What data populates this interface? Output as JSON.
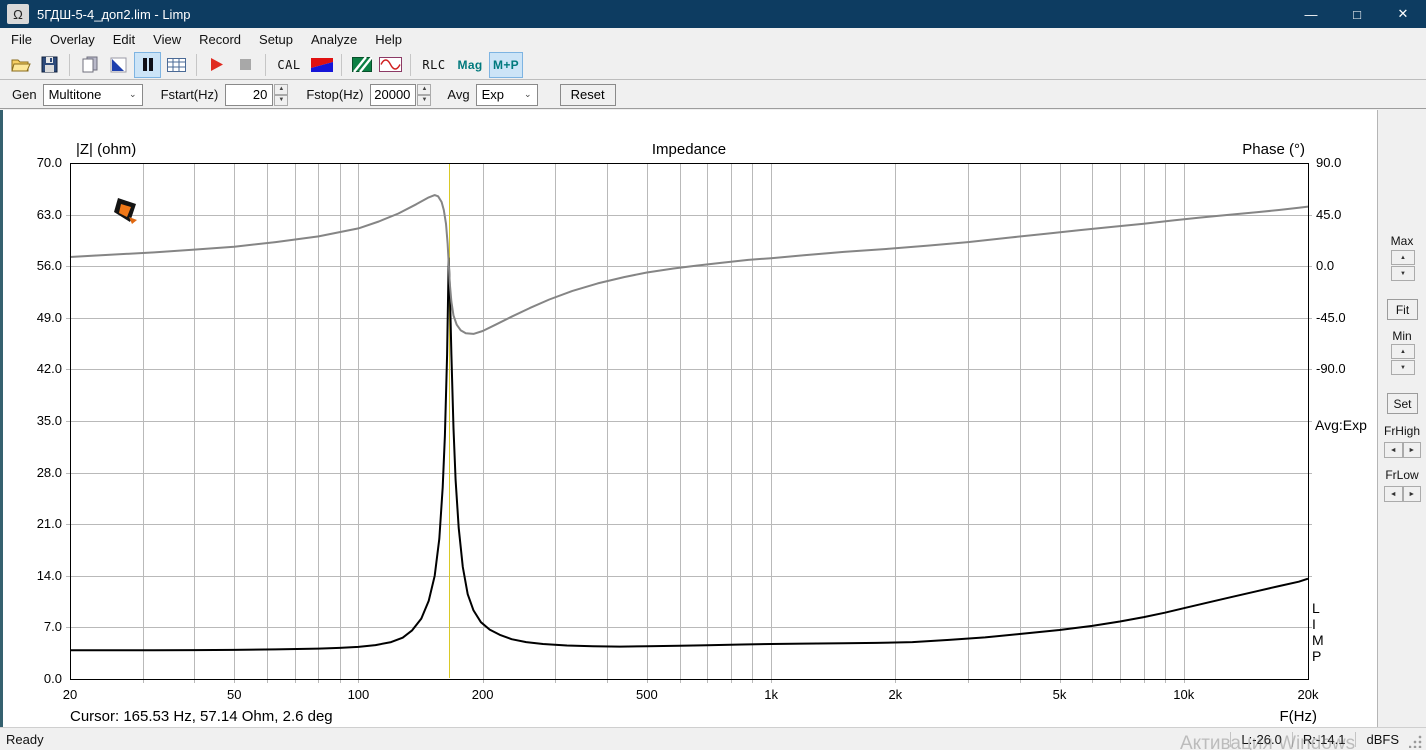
{
  "window": {
    "title": "5ГДШ-5-4_доп2.lim - Limp",
    "app_icon_glyph": "Ω",
    "minimize_glyph": "—",
    "maximize_glyph": "□",
    "close_glyph": "✕"
  },
  "menubar": {
    "items": [
      "File",
      "Overlay",
      "Edit",
      "View",
      "Record",
      "Setup",
      "Analyze",
      "Help"
    ]
  },
  "toolbar": {
    "cal_label": "CAL",
    "rlc_label": "RLC",
    "mag_label": "Mag",
    "mp_label": "M+P"
  },
  "controls": {
    "gen_label": "Gen",
    "gen_value": "Multitone",
    "fstart_label": "Fstart(Hz)",
    "fstart_value": "20",
    "fstop_label": "Fstop(Hz)",
    "fstop_value": "20000",
    "avg_label": "Avg",
    "avg_value": "Exp",
    "reset_label": "Reset"
  },
  "right_panel": {
    "max_label": "Max",
    "fit_label": "Fit",
    "min_label": "Min",
    "set_label": "Set",
    "frhigh_label": "FrHigh",
    "frlow_label": "FrLow"
  },
  "chart_data": {
    "type": "line",
    "title": "Impedance",
    "left_axis_label": "|Z| (ohm)",
    "right_axis_label": "Phase (°)",
    "x_axis_label": "F(Hz)",
    "x_scale": "log",
    "grid": true,
    "x_range": [
      20,
      20000
    ],
    "left_range": [
      0,
      70
    ],
    "right_range": [
      -90,
      90
    ],
    "left_ticks": [
      {
        "v": 70,
        "label": "70.0"
      },
      {
        "v": 63,
        "label": "63.0"
      },
      {
        "v": 56,
        "label": "56.0"
      },
      {
        "v": 49,
        "label": "49.0"
      },
      {
        "v": 42,
        "label": "42.0"
      },
      {
        "v": 35,
        "label": "35.0"
      },
      {
        "v": 28,
        "label": "28.0"
      },
      {
        "v": 21,
        "label": "21.0"
      },
      {
        "v": 14,
        "label": "14.0"
      },
      {
        "v": 7,
        "label": "7.0"
      },
      {
        "v": 0,
        "label": "0.0"
      }
    ],
    "right_ticks": [
      {
        "v": 90,
        "label": "90.0"
      },
      {
        "v": 45,
        "label": "45.0"
      },
      {
        "v": 0,
        "label": "0.0"
      },
      {
        "v": -45,
        "label": "-45.0"
      },
      {
        "v": -90,
        "label": "-90.0"
      }
    ],
    "x_ticks": [
      {
        "f": 20,
        "label": "20"
      },
      {
        "f": 50,
        "label": "50"
      },
      {
        "f": 100,
        "label": "100"
      },
      {
        "f": 200,
        "label": "200"
      },
      {
        "f": 500,
        "label": "500"
      },
      {
        "f": 1000,
        "label": "1k"
      },
      {
        "f": 2000,
        "label": "2k"
      },
      {
        "f": 5000,
        "label": "5k"
      },
      {
        "f": 10000,
        "label": "10k"
      },
      {
        "f": 20000,
        "label": "20k"
      }
    ],
    "cursor": {
      "freq": 165.53,
      "readout": "Cursor: 165.53 Hz, 57.14 Ohm, 2.6 deg",
      "color": "#d9c927"
    },
    "avg_text": "Avg:Exp",
    "corner_text": "LIMP",
    "grid_color": "#b9b9b9",
    "series": [
      {
        "name": "Impedance |Z|",
        "axis": "left",
        "color": "#000000",
        "points": [
          [
            20,
            3.9
          ],
          [
            25,
            3.9
          ],
          [
            32,
            3.9
          ],
          [
            40,
            3.92
          ],
          [
            50,
            3.95
          ],
          [
            63,
            4.02
          ],
          [
            80,
            4.12
          ],
          [
            90,
            4.22
          ],
          [
            100,
            4.35
          ],
          [
            110,
            4.6
          ],
          [
            120,
            5.0
          ],
          [
            128,
            5.6
          ],
          [
            135,
            6.6
          ],
          [
            142,
            8.2
          ],
          [
            148,
            10.6
          ],
          [
            153,
            14
          ],
          [
            157,
            19
          ],
          [
            160,
            26
          ],
          [
            162,
            33
          ],
          [
            164,
            44
          ],
          [
            165.5,
            57.1
          ],
          [
            166.5,
            53
          ],
          [
            168,
            44
          ],
          [
            170,
            34
          ],
          [
            172,
            27
          ],
          [
            175,
            20.5
          ],
          [
            179,
            15.2
          ],
          [
            184,
            11.5
          ],
          [
            190,
            9.3
          ],
          [
            198,
            7.7
          ],
          [
            208,
            6.7
          ],
          [
            220,
            6.0
          ],
          [
            235,
            5.4
          ],
          [
            255,
            5.0
          ],
          [
            280,
            4.75
          ],
          [
            320,
            4.55
          ],
          [
            370,
            4.45
          ],
          [
            430,
            4.4
          ],
          [
            500,
            4.45
          ],
          [
            600,
            4.5
          ],
          [
            700,
            4.58
          ],
          [
            850,
            4.68
          ],
          [
            1000,
            4.75
          ],
          [
            1200,
            4.8
          ],
          [
            1500,
            4.85
          ],
          [
            1800,
            4.9
          ],
          [
            2200,
            5.0
          ],
          [
            2700,
            5.3
          ],
          [
            3300,
            5.65
          ],
          [
            4000,
            6.1
          ],
          [
            5000,
            6.65
          ],
          [
            6000,
            7.2
          ],
          [
            7000,
            7.8
          ],
          [
            8000,
            8.4
          ],
          [
            9000,
            9.0
          ],
          [
            10000,
            9.6
          ],
          [
            11500,
            10.4
          ],
          [
            13000,
            11.1
          ],
          [
            15000,
            11.9
          ],
          [
            17000,
            12.6
          ],
          [
            19000,
            13.2
          ],
          [
            20000,
            13.6
          ]
        ]
      },
      {
        "name": "Phase",
        "axis": "right",
        "color": "#858585",
        "points": [
          [
            20,
            8
          ],
          [
            25,
            10
          ],
          [
            32,
            12
          ],
          [
            40,
            14.5
          ],
          [
            50,
            17
          ],
          [
            63,
            21
          ],
          [
            80,
            26
          ],
          [
            100,
            33
          ],
          [
            112,
            39
          ],
          [
            125,
            46
          ],
          [
            138,
            54
          ],
          [
            148,
            60
          ],
          [
            153,
            62
          ],
          [
            156,
            61
          ],
          [
            159,
            56
          ],
          [
            161,
            49
          ],
          [
            163,
            37
          ],
          [
            164.5,
            20
          ],
          [
            165.5,
            2.6
          ],
          [
            166.5,
            -15
          ],
          [
            168,
            -31
          ],
          [
            170,
            -43
          ],
          [
            173,
            -51
          ],
          [
            177,
            -56
          ],
          [
            182,
            -58.5
          ],
          [
            190,
            -59
          ],
          [
            200,
            -56.5
          ],
          [
            215,
            -51
          ],
          [
            235,
            -44
          ],
          [
            260,
            -36.5
          ],
          [
            290,
            -29
          ],
          [
            330,
            -21.5
          ],
          [
            380,
            -15
          ],
          [
            440,
            -9.5
          ],
          [
            500,
            -5.5
          ],
          [
            580,
            -2
          ],
          [
            660,
            0.5
          ],
          [
            760,
            3
          ],
          [
            880,
            5.5
          ],
          [
            1000,
            7
          ],
          [
            1200,
            9.5
          ],
          [
            1500,
            12.5
          ],
          [
            1900,
            15
          ],
          [
            2400,
            18
          ],
          [
            3000,
            21
          ],
          [
            3800,
            25
          ],
          [
            4700,
            28.5
          ],
          [
            5600,
            31.5
          ],
          [
            6800,
            34.5
          ],
          [
            8000,
            37
          ],
          [
            9500,
            40
          ],
          [
            11000,
            42.5
          ],
          [
            13000,
            45
          ],
          [
            15000,
            47
          ],
          [
            17000,
            49
          ],
          [
            19000,
            51
          ],
          [
            20000,
            52
          ]
        ]
      }
    ]
  },
  "statusbar": {
    "ready": "Ready",
    "l_level": "L:-26.0",
    "r_level": "R:-14.1",
    "units": "dBFS"
  },
  "watermark": "Активация Windows",
  "colors": {
    "titlebar": "#0d3c61",
    "teal_text": "#00797d",
    "cursor_line": "#d9c927",
    "impedance_curve": "#000000",
    "phase_curve": "#858585"
  }
}
